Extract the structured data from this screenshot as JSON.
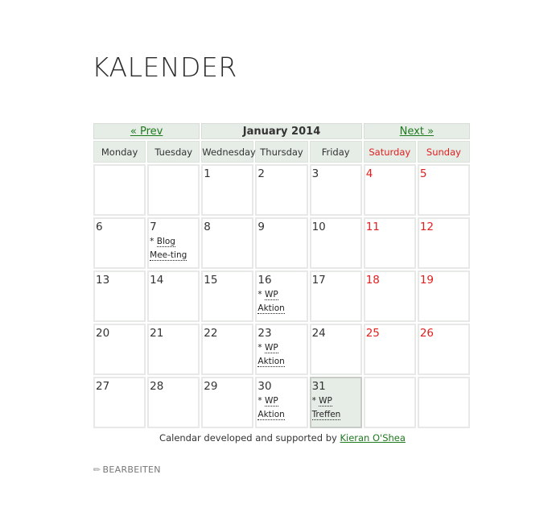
{
  "page": {
    "title": "KALENDER"
  },
  "calendar": {
    "prev_label": "« Prev",
    "next_label": "Next »",
    "month_title": "January 2014",
    "weekdays": [
      {
        "label": "Monday",
        "weekend": false
      },
      {
        "label": "Tuesday",
        "weekend": false
      },
      {
        "label": "Wednesday",
        "weekend": false
      },
      {
        "label": "Thursday",
        "weekend": false
      },
      {
        "label": "Friday",
        "weekend": false
      },
      {
        "label": "Saturday",
        "weekend": true
      },
      {
        "label": "Sunday",
        "weekend": true
      }
    ],
    "weeks": [
      [
        {
          "day": "",
          "events": []
        },
        {
          "day": "",
          "events": []
        },
        {
          "day": "1",
          "events": []
        },
        {
          "day": "2",
          "events": []
        },
        {
          "day": "3",
          "events": []
        },
        {
          "day": "4",
          "events": []
        },
        {
          "day": "5",
          "events": []
        }
      ],
      [
        {
          "day": "6",
          "events": []
        },
        {
          "day": "7",
          "events": [
            "Blog Mee-ting"
          ]
        },
        {
          "day": "8",
          "events": []
        },
        {
          "day": "9",
          "events": []
        },
        {
          "day": "10",
          "events": []
        },
        {
          "day": "11",
          "events": []
        },
        {
          "day": "12",
          "events": []
        }
      ],
      [
        {
          "day": "13",
          "events": []
        },
        {
          "day": "14",
          "events": []
        },
        {
          "day": "15",
          "events": []
        },
        {
          "day": "16",
          "events": [
            "WP Aktion"
          ]
        },
        {
          "day": "17",
          "events": []
        },
        {
          "day": "18",
          "events": []
        },
        {
          "day": "19",
          "events": []
        }
      ],
      [
        {
          "day": "20",
          "events": []
        },
        {
          "day": "21",
          "events": []
        },
        {
          "day": "22",
          "events": []
        },
        {
          "day": "23",
          "events": [
            "WP Aktion"
          ]
        },
        {
          "day": "24",
          "events": []
        },
        {
          "day": "25",
          "events": []
        },
        {
          "day": "26",
          "events": []
        }
      ],
      [
        {
          "day": "27",
          "events": []
        },
        {
          "day": "28",
          "events": []
        },
        {
          "day": "29",
          "events": []
        },
        {
          "day": "30",
          "events": [
            "WP Aktion"
          ]
        },
        {
          "day": "31",
          "events": [
            "WP Treffen"
          ],
          "today": true
        },
        {
          "day": "",
          "events": []
        },
        {
          "day": "",
          "events": []
        }
      ]
    ],
    "event_prefix": "* "
  },
  "credit": {
    "text": "Calendar developed and supported by ",
    "link_label": "Kieran O'Shea"
  },
  "edit": {
    "icon": "pencil-icon",
    "label": "BEARBEITEN"
  },
  "colors": {
    "link": "#1e7a1e",
    "weekend": "#e02020",
    "header_bg": "#e6ece6"
  }
}
